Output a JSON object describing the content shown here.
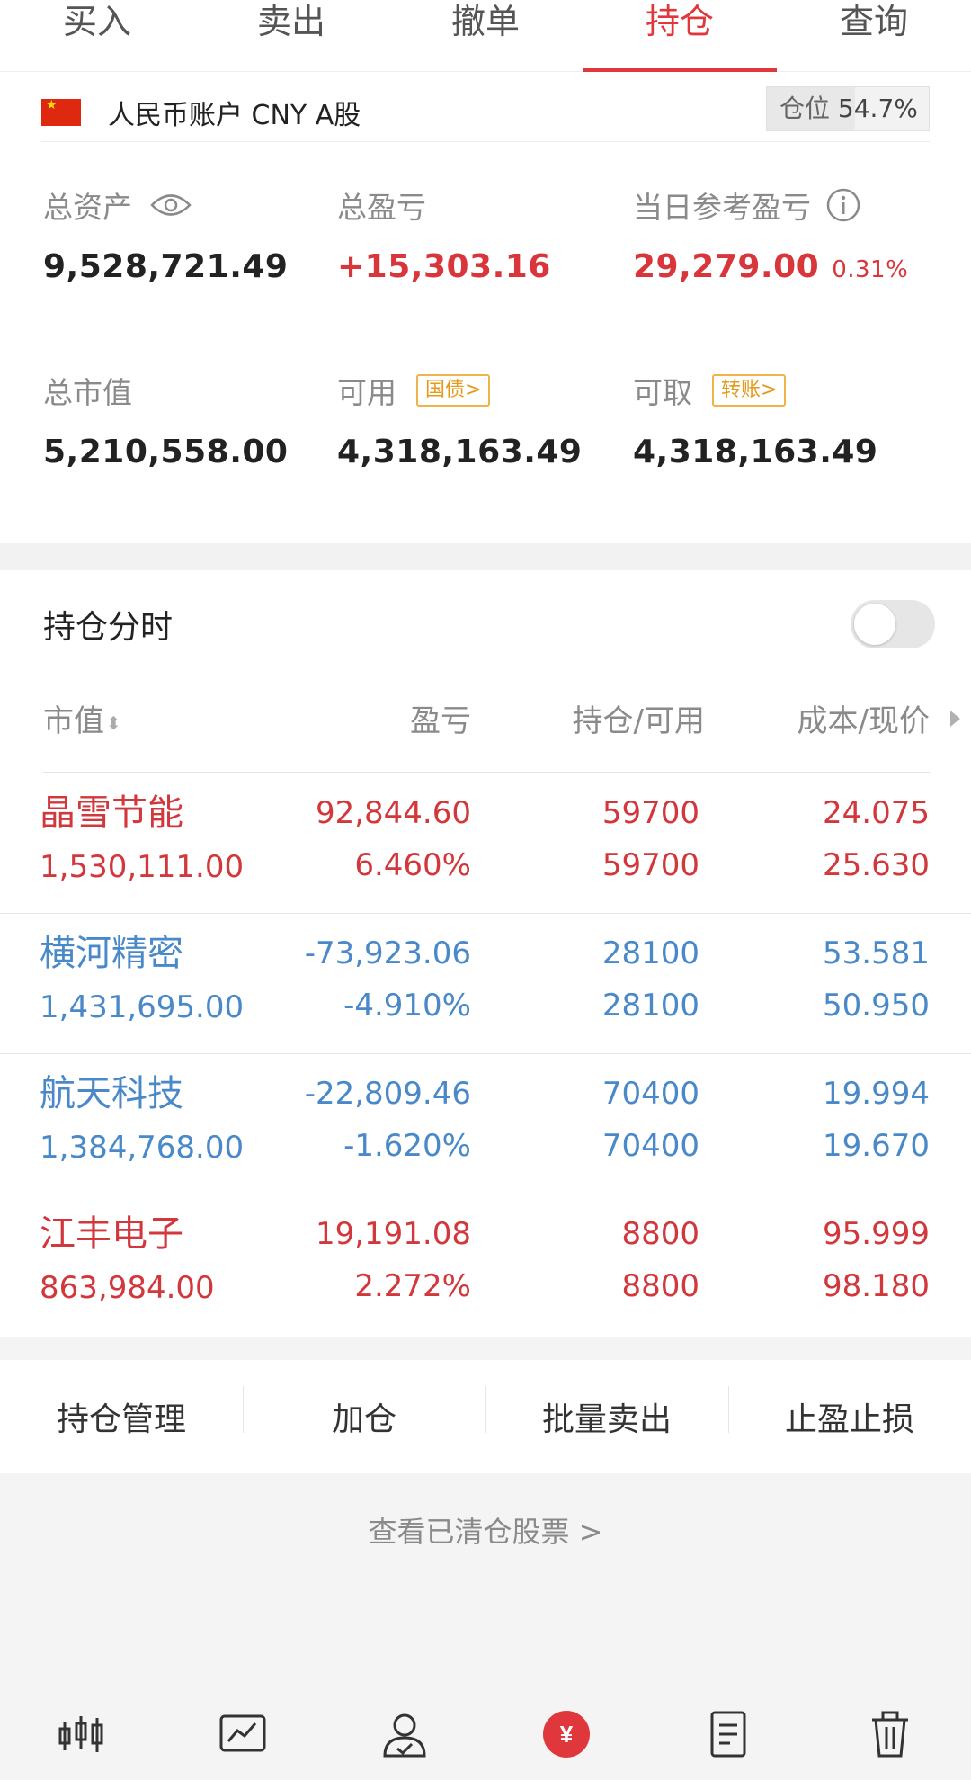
{
  "tabs": [
    "买入",
    "卖出",
    "撤单",
    "持仓",
    "查询"
  ],
  "active_tab": "持仓",
  "account": {
    "label": "人民币账户 CNY A股",
    "position_label": "仓位",
    "position_value": "54.7%",
    "position_fraction": 0.547
  },
  "summary": {
    "total_assets_label": "总资产",
    "total_assets": "9,528,721.49",
    "total_pl_label": "总盈亏",
    "total_pl": "+15,303.16",
    "daily_pl_label": "当日参考盈亏",
    "daily_pl": "29,279.00",
    "daily_pl_pct": "0.31%",
    "market_value_label": "总市值",
    "market_value": "5,210,558.00",
    "available_label": "可用",
    "available_tag": "国债>",
    "available": "4,318,163.49",
    "withdrawable_label": "可取",
    "withdrawable_tag": "转账>",
    "withdrawable": "4,318,163.49"
  },
  "split": {
    "label": "持仓分时",
    "toggle_on": false
  },
  "columns": {
    "market_value": "市值",
    "pl": "盈亏",
    "hold": "持仓/可用",
    "cost": "成本/现价"
  },
  "holdings": [
    {
      "name": "晶雪节能",
      "market_value": "1,530,111.00",
      "pl": "92,844.60",
      "pl_pct": "6.460%",
      "hold": "59700",
      "available": "59700",
      "cost": "24.075",
      "price": "25.630",
      "trend": "up"
    },
    {
      "name": "横河精密",
      "market_value": "1,431,695.00",
      "pl": "-73,923.06",
      "pl_pct": "-4.910%",
      "hold": "28100",
      "available": "28100",
      "cost": "53.581",
      "price": "50.950",
      "trend": "down"
    },
    {
      "name": "航天科技",
      "market_value": "1,384,768.00",
      "pl": "-22,809.46",
      "pl_pct": "-1.620%",
      "hold": "70400",
      "available": "70400",
      "cost": "19.994",
      "price": "19.670",
      "trend": "down"
    },
    {
      "name": "江丰电子",
      "market_value": "863,984.00",
      "pl": "19,191.08",
      "pl_pct": "2.272%",
      "hold": "8800",
      "available": "8800",
      "cost": "95.999",
      "price": "98.180",
      "trend": "up"
    }
  ],
  "actions": [
    "持仓管理",
    "加仓",
    "批量卖出",
    "止盈止损"
  ],
  "cleared_link": "查看已清仓股票 >",
  "nav_icons": [
    "kline-icon",
    "chart-icon",
    "user-icon",
    "yuan-icon",
    "document-icon",
    "trash-icon"
  ],
  "colors": {
    "accent": "#e0373c",
    "up": "#d2373c",
    "down": "#4a89c9",
    "tag": "#e59a1c"
  },
  "yuan_symbol": "¥"
}
